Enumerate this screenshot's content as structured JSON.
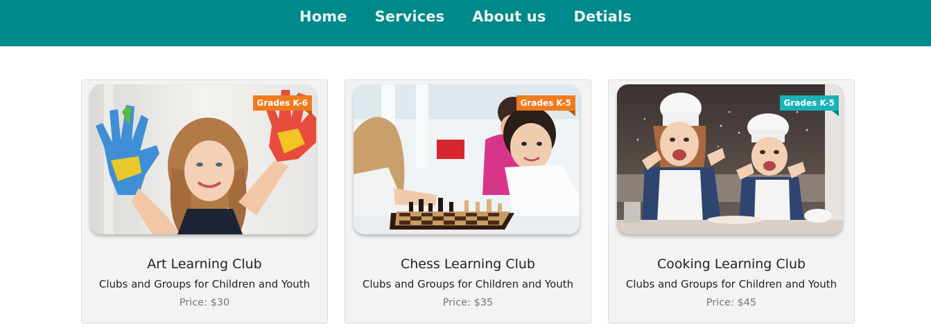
{
  "nav": {
    "items": [
      {
        "label": "Home"
      },
      {
        "label": "Services"
      },
      {
        "label": "About us"
      },
      {
        "label": "Detials"
      }
    ]
  },
  "cards": [
    {
      "badge": "Grades K-6",
      "badge_color": "#f07b1e",
      "badge_fold": "#b85b10",
      "title": "Art Learning Club",
      "subtitle": "Clubs and Groups for Children and Youth",
      "price": "Price: $30"
    },
    {
      "badge": "Grades K-5",
      "badge_color": "#f07b1e",
      "badge_fold": "#b85b10",
      "title": "Chess Learning Club",
      "subtitle": "Clubs and Groups for Children and Youth",
      "price": "Price: $35"
    },
    {
      "badge": "Grades K-5",
      "badge_color": "#17b3b7",
      "badge_fold": "#0d7f82",
      "title": "Cooking Learning Club",
      "subtitle": "Clubs and Groups for Children and Youth",
      "price": "Price: $45"
    }
  ],
  "colors": {
    "navbar": "#00898a",
    "card_bg": "#f3f3f3"
  }
}
